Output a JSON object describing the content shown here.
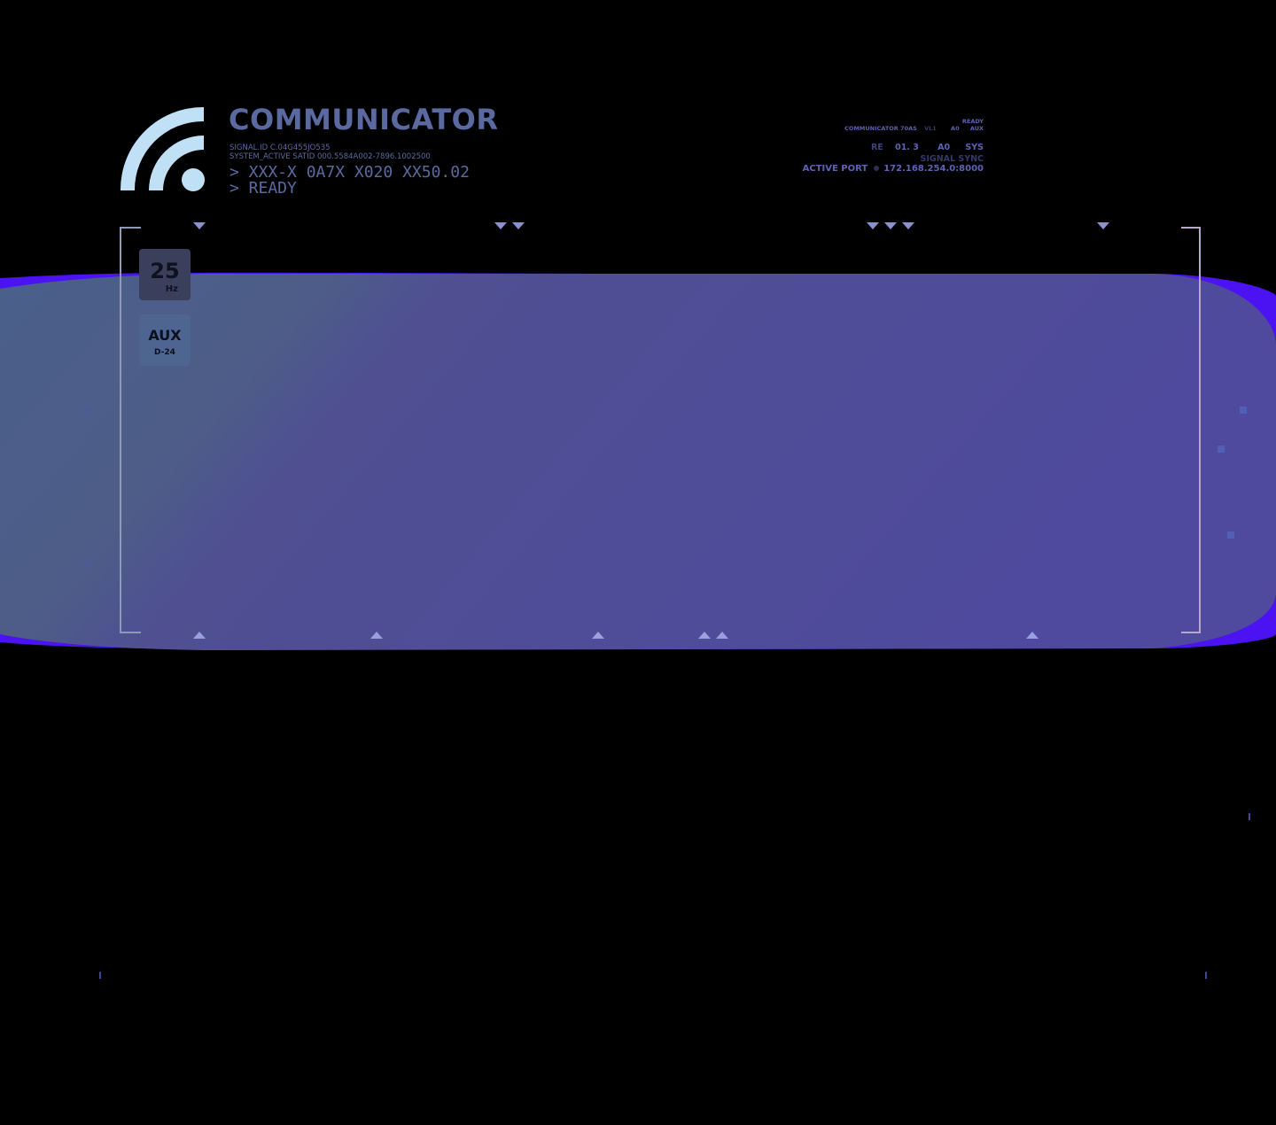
{
  "header": {
    "title": "COMMUNICATOR",
    "signal_id": "SIGNAL.ID C.04G455JO535",
    "system_active": "SYSTEM_ACTIVE SATID 000.5584A002-7896.1002500",
    "console_line_1": "> XXX-X 0A7X X020 XX50.02",
    "console_line_2": "> READY"
  },
  "status": {
    "ready": "READY",
    "model": "COMMUNICATOR 70AS",
    "model_sub": "VL1",
    "a0": "A0",
    "aux": "AUX",
    "re": "RE",
    "version": "01. 3",
    "a0_b": "A0",
    "sys": "SYS",
    "signal_sync": "SIGNAL SYNC",
    "active_port_label": "ACTIVE PORT",
    "active_port_value": "172.168.254.0:8000"
  },
  "side_panel": {
    "freq_value": "25",
    "freq_unit": "Hz",
    "aux_label": "AUX",
    "aux_sub": "D-24"
  },
  "colors": {
    "background": "#000000",
    "band_fill_left": "#4a5d8c",
    "band_fill_right": "#4f4a9e",
    "band_edge": "#4b12f2",
    "logo": "#bfe0f5",
    "title_text": "#5a6aa0",
    "marker": "#8a8fd6"
  },
  "icons": {
    "logo": "wifi-signal-icon"
  }
}
